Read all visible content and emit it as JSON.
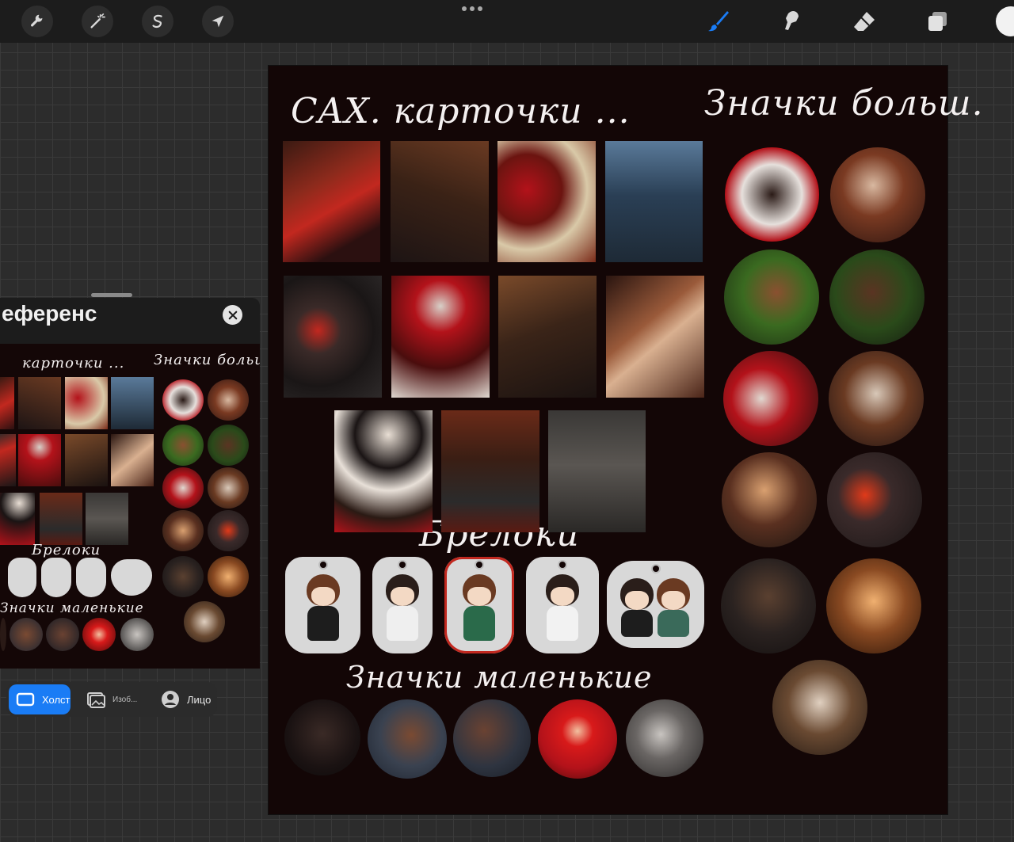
{
  "toolbar": {
    "left_tools": [
      {
        "icon": "wrench-icon",
        "name": "actions"
      },
      {
        "icon": "magic-wand-icon",
        "name": "adjustments"
      },
      {
        "icon": "selection-s-icon",
        "name": "selection"
      },
      {
        "icon": "arrow-cursor-icon",
        "name": "transform"
      }
    ],
    "right_tools": [
      {
        "icon": "brush-icon",
        "name": "paint",
        "color": "#1a7cf5"
      },
      {
        "icon": "smudge-icon",
        "name": "smudge"
      },
      {
        "icon": "eraser-icon",
        "name": "erase"
      },
      {
        "icon": "layers-icon",
        "name": "layers"
      }
    ],
    "more_icon": "ellipsis-icon",
    "color_well": "#f2f2f2"
  },
  "canvas": {
    "background": "#130606",
    "titles": {
      "cards": "CAX. карточки ...",
      "badges_big": "Значки больш.",
      "charms": "Брелоки",
      "badges_small": "Значки маленькие"
    }
  },
  "reference_panel": {
    "title": "еференс",
    "close_icon": "close-icon",
    "mini_titles": {
      "cards": "карточки ...",
      "badges_big": "Значки больш.",
      "charms": "Брелоки",
      "badges_small": "Значки маленькие"
    },
    "tabs": [
      {
        "label": "Холст",
        "icon": "canvas-icon",
        "active": true
      },
      {
        "label": "Изоб...",
        "icon": "image-icon",
        "active": false
      },
      {
        "label": "Лицо",
        "icon": "face-icon",
        "active": false
      }
    ]
  },
  "colors": {
    "accent": "#1a7cf5",
    "art_red": "#b3121a",
    "art_brown": "#6b3a22",
    "art_dark": "#1d1414"
  }
}
